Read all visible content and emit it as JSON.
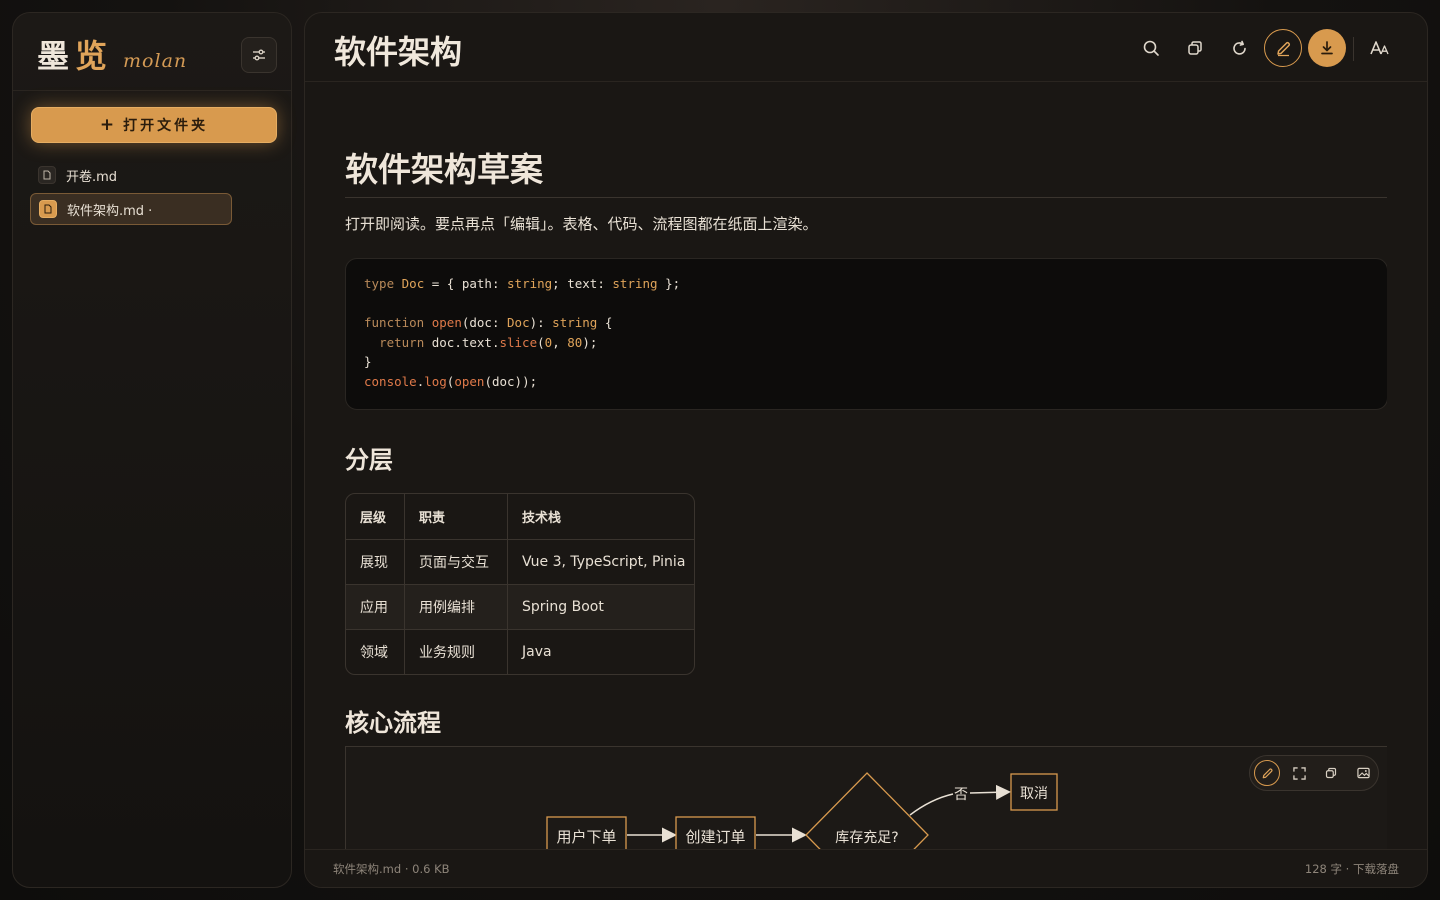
{
  "sidebar": {
    "brand_cn_1": "墨",
    "brand_cn_2": "览",
    "brand_en": "molan",
    "open_folder_label": "打开文件夹",
    "files": [
      {
        "name": "开卷.md"
      },
      {
        "name": "软件架构.md ·"
      }
    ]
  },
  "header": {
    "title": "软件架构"
  },
  "document": {
    "h1": "软件架构草案",
    "intro": "打开即阅读。要点再点「编辑」。表格、代码、流程图都在纸面上渲染。",
    "code_lines": [
      "type Doc = { path: string; text: string };",
      "",
      "function open(doc: Doc): string {",
      "  return doc.text.slice(0, 80);",
      "}",
      "console.log(open(doc));"
    ],
    "section_layers": "分层",
    "table": {
      "headers": [
        "层级",
        "职责",
        "技术栈"
      ],
      "rows": [
        [
          "展现",
          "页面与交互",
          "Vue 3, TypeScript, Pinia"
        ],
        [
          "应用",
          "用例编排",
          "Spring Boot"
        ],
        [
          "领域",
          "业务规则",
          "Java"
        ]
      ]
    },
    "section_flow": "核心流程",
    "flow": {
      "node_user_order": "用户下单",
      "node_create_order": "创建订单",
      "node_stock_check": "库存充足?",
      "edge_no": "否",
      "node_cancel": "取消"
    }
  },
  "footer": {
    "file_info": "软件架构.md · 0.6 KB",
    "stats": "128 字 · 下载落盘"
  },
  "colors": {
    "accent": "#d89a4e",
    "background": "#1a1714",
    "code_background": "#0d0c0b"
  }
}
